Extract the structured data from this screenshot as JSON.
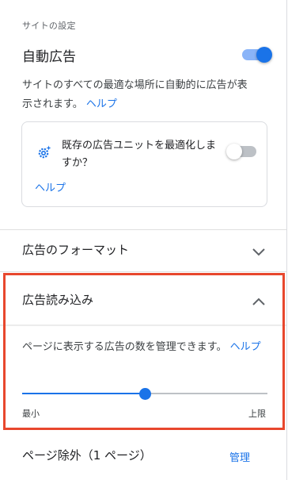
{
  "site_settings": {
    "section_label": "サイトの設定",
    "auto_ads": {
      "title": "自動広告",
      "enabled": true,
      "description": "サイトのすべての最適な場所に自動的に広告が表示されます。",
      "help_label": "ヘルプ"
    },
    "optimize_card": {
      "text": "既存の広告ユニットを最適化しますか？",
      "enabled": false,
      "help_label": "ヘルプ",
      "icon": "gear-sparkle-icon"
    }
  },
  "ad_format": {
    "title": "広告のフォーマット",
    "expanded": false
  },
  "ad_load": {
    "title": "広告読み込み",
    "expanded": true,
    "description": "ページに表示する広告の数を管理できます。",
    "help_label": "ヘルプ",
    "slider": {
      "min_label": "最小",
      "max_label": "上限",
      "value_fraction": 0.5
    }
  },
  "page_exclusions": {
    "title": "ページ除外（1 ページ）",
    "manage_label": "管理"
  },
  "colors": {
    "accent": "#1a73e8",
    "highlight": "#e8472d"
  }
}
